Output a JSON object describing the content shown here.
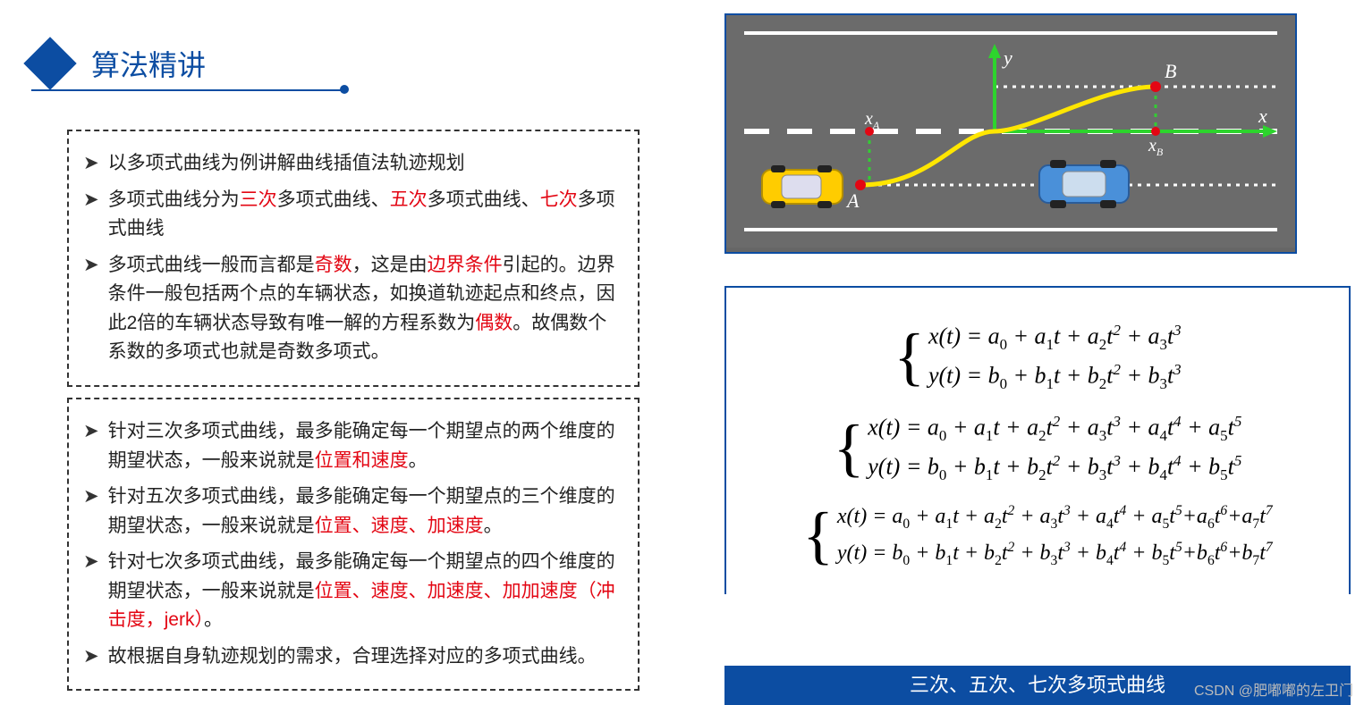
{
  "header": {
    "title": "算法精讲"
  },
  "box1": {
    "items": [
      {
        "segments": [
          {
            "t": "以多项式曲线为例讲解曲线插值法轨迹规划"
          }
        ]
      },
      {
        "segments": [
          {
            "t": "多项式曲线分为"
          },
          {
            "t": "三次",
            "red": true
          },
          {
            "t": "多项式曲线、"
          },
          {
            "t": "五次",
            "red": true
          },
          {
            "t": "多项式曲线、"
          },
          {
            "t": "七次",
            "red": true
          },
          {
            "t": "多项式曲线"
          }
        ]
      },
      {
        "segments": [
          {
            "t": "多项式曲线一般而言都是"
          },
          {
            "t": "奇数",
            "red": true
          },
          {
            "t": "，这是由"
          },
          {
            "t": "边界条件",
            "red": true
          },
          {
            "t": "引起的。边界条件一般包括两个点的车辆状态，如换道轨迹起点和终点，因此2倍的车辆状态导致有唯一解的方程系数为"
          },
          {
            "t": "偶数",
            "red": true
          },
          {
            "t": "。故偶数个系数的多项式也就是奇数多项式。"
          }
        ]
      }
    ]
  },
  "box2": {
    "items": [
      {
        "segments": [
          {
            "t": "针对三次多项式曲线，最多能确定每一个期望点的两个维度的期望状态，一般来说就是"
          },
          {
            "t": "位置和速度",
            "red": true
          },
          {
            "t": "。"
          }
        ]
      },
      {
        "segments": [
          {
            "t": "针对五次多项式曲线，最多能确定每一个期望点的三个维度的期望状态，一般来说就是"
          },
          {
            "t": "位置、速度、加速度",
            "red": true
          },
          {
            "t": "。"
          }
        ]
      },
      {
        "segments": [
          {
            "t": "针对七次多项式曲线，最多能确定每一个期望点的四个维度的期望状态，一般来说就是"
          },
          {
            "t": "位置、速度、加速度、加加速度（冲击度，jerk）",
            "red": true
          },
          {
            "t": "。"
          }
        ]
      },
      {
        "segments": [
          {
            "t": "故根据自身轨迹规划的需求，合理选择对应的多项式曲线。"
          }
        ]
      }
    ]
  },
  "diagram": {
    "labels": {
      "A": "A",
      "B": "B",
      "xA": "x_A",
      "xB": "x_B",
      "y": "y",
      "x": "x"
    }
  },
  "equations": {
    "cubic": {
      "x": "x(t) = a₀ + a₁t + a₂t² + a₃t³",
      "y": "y(t) = b₀ + b₁t + b₂t² + b₃t³"
    },
    "quintic": {
      "x": "x(t) = a₀ + a₁t + a₂t² + a₃t³ + a₄t⁴ + a₅t⁵",
      "y": "y(t) = b₀ + b₁t + b₂t² + b₃t³ + b₄t⁴ + b₅t⁵"
    },
    "septic": {
      "x": "x(t) = a₀ + a₁t + a₂t² + a₃t³ + a₄t⁴ + a₅t⁵ + a₆t⁶ + a₇t⁷",
      "y": "y(t) = b₀ + b₁t + b₂t² + b₃t³ + b₄t⁴ + b₅t⁵ + b₆t⁶ + b₇t⁷"
    }
  },
  "caption": "三次、五次、七次多项式曲线",
  "watermark": "CSDN @肥嘟嘟的左卫门"
}
